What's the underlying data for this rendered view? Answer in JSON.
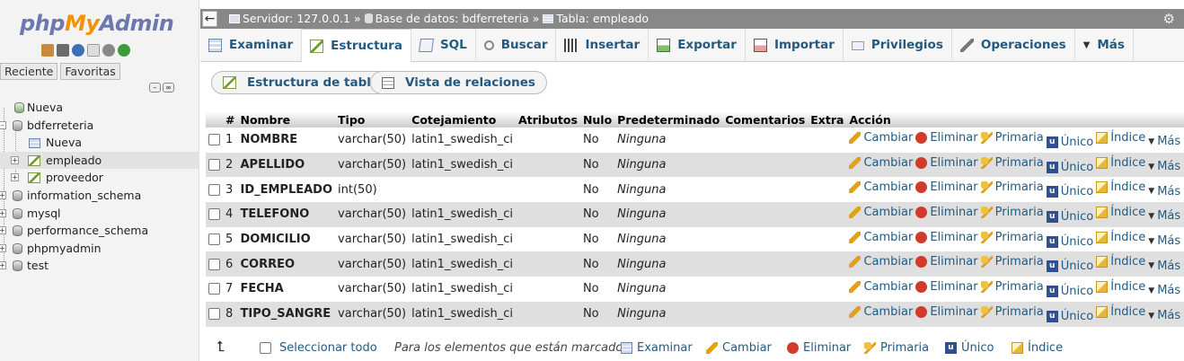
{
  "logo": {
    "php": "php",
    "my": "My",
    "admin": "Admin"
  },
  "nav_tabs": {
    "recent": "Reciente",
    "favorites": "Favoritas"
  },
  "tree": [
    {
      "label": "Nueva"
    },
    {
      "label": "bdferreteria"
    },
    {
      "label": "Nueva"
    },
    {
      "label": "empleado"
    },
    {
      "label": "proveedor"
    },
    {
      "label": "information_schema"
    },
    {
      "label": "mysql"
    },
    {
      "label": "performance_schema"
    },
    {
      "label": "phpmyadmin"
    },
    {
      "label": "test"
    }
  ],
  "breadcrumb": {
    "server": "Servidor: 127.0.0.1",
    "sep1": "»",
    "database": "Base de datos: bdferreteria",
    "sep2": "»",
    "table": "Tabla: empleado"
  },
  "tabs": [
    {
      "label": "Examinar",
      "icon": "browse-icon"
    },
    {
      "label": "Estructura",
      "icon": "structure-icon"
    },
    {
      "label": "SQL",
      "icon": "sql-icon"
    },
    {
      "label": "Buscar",
      "icon": "search-icon"
    },
    {
      "label": "Insertar",
      "icon": "insert-icon"
    },
    {
      "label": "Exportar",
      "icon": "export-icon"
    },
    {
      "label": "Importar",
      "icon": "import-icon"
    },
    {
      "label": "Privilegios",
      "icon": "privileges-icon"
    },
    {
      "label": "Operaciones",
      "icon": "wrench-icon"
    },
    {
      "label": "Más",
      "icon": "chevron-down-icon"
    }
  ],
  "subtabs": {
    "structure": "Estructura de tabla",
    "relations": "Vista de relaciones"
  },
  "columns": [
    "#",
    "Nombre",
    "Tipo",
    "Cotejamiento",
    "Atributos",
    "Nulo",
    "Predeterminado",
    "Comentarios",
    "Extra",
    "Acción"
  ],
  "rows": [
    {
      "num": "1",
      "name": "NOMBRE",
      "type": "varchar(50)",
      "collation": "latin1_swedish_ci",
      "attributes": "",
      "null": "No",
      "default": "Ninguna",
      "comments": "",
      "extra": ""
    },
    {
      "num": "2",
      "name": "APELLIDO",
      "type": "varchar(50)",
      "collation": "latin1_swedish_ci",
      "attributes": "",
      "null": "No",
      "default": "Ninguna",
      "comments": "",
      "extra": ""
    },
    {
      "num": "3",
      "name": "ID_EMPLEADO",
      "type": "int(50)",
      "collation": "",
      "attributes": "",
      "null": "No",
      "default": "Ninguna",
      "comments": "",
      "extra": ""
    },
    {
      "num": "4",
      "name": "TELEFONO",
      "type": "varchar(50)",
      "collation": "latin1_swedish_ci",
      "attributes": "",
      "null": "No",
      "default": "Ninguna",
      "comments": "",
      "extra": ""
    },
    {
      "num": "5",
      "name": "DOMICILIO",
      "type": "varchar(50)",
      "collation": "latin1_swedish_ci",
      "attributes": "",
      "null": "No",
      "default": "Ninguna",
      "comments": "",
      "extra": ""
    },
    {
      "num": "6",
      "name": "CORREO",
      "type": "varchar(50)",
      "collation": "latin1_swedish_ci",
      "attributes": "",
      "null": "No",
      "default": "Ninguna",
      "comments": "",
      "extra": ""
    },
    {
      "num": "7",
      "name": "FECHA",
      "type": "varchar(50)",
      "collation": "latin1_swedish_ci",
      "attributes": "",
      "null": "No",
      "default": "Ninguna",
      "comments": "",
      "extra": ""
    },
    {
      "num": "8",
      "name": "TIPO_SANGRE",
      "type": "varchar(50)",
      "collation": "latin1_swedish_ci",
      "attributes": "",
      "null": "No",
      "default": "Ninguna",
      "comments": "",
      "extra": ""
    }
  ],
  "row_actions": {
    "change": "Cambiar",
    "drop": "Eliminar",
    "primary": "Primaria",
    "unique": "Único",
    "index": "Índice",
    "more": "Más"
  },
  "footer": {
    "select_all": "Seleccionar todo",
    "with_selected": "Para los elementos que están marcados:",
    "browse": "Examinar",
    "change": "Cambiar",
    "drop": "Eliminar",
    "primary": "Primaria",
    "unique": "Único",
    "index": "Índice"
  },
  "colors": {
    "link": "#235a81",
    "topbar": "#888888",
    "row_alt": "#dfdfdf"
  }
}
